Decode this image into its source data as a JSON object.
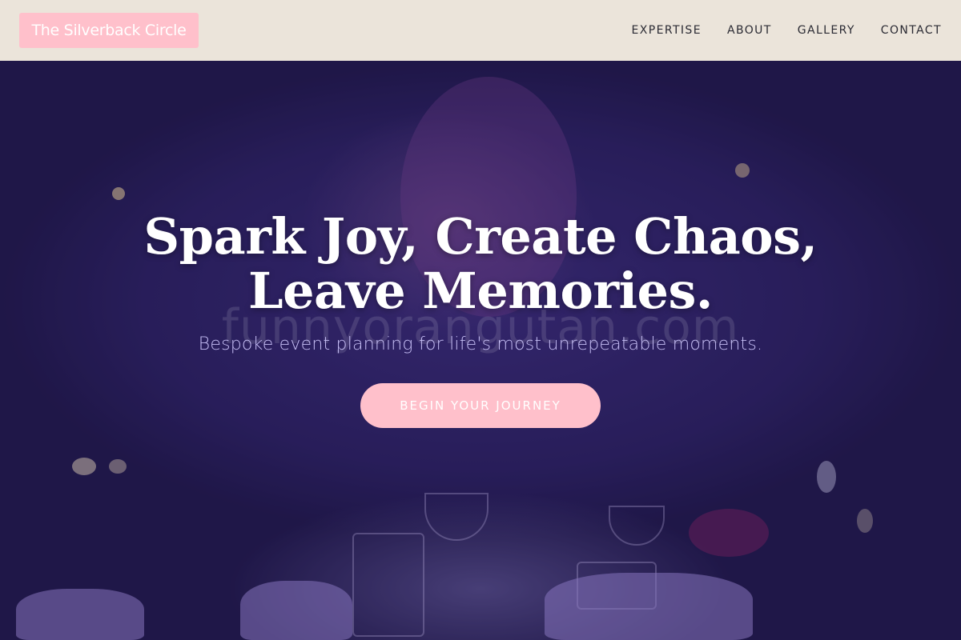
{
  "navbar": {
    "logo": "The Silverback Circle",
    "links": [
      {
        "label": "EXPERTISE"
      },
      {
        "label": "ABOUT"
      },
      {
        "label": "GALLERY"
      },
      {
        "label": "CONTACT"
      }
    ]
  },
  "hero": {
    "headline_line1": "Spark Joy, Create Chaos,",
    "headline_line2": "Leave Memories.",
    "subtitle": "Bespoke event planning for life's most unrepeatable moments.",
    "cta_label": "BEGIN YOUR JOURNEY",
    "watermark": "funnyorangutan.com"
  },
  "colors": {
    "accent": "#ffc0cb",
    "nav_bg": "#ebe4da",
    "hero_bg": "#2b2160"
  }
}
